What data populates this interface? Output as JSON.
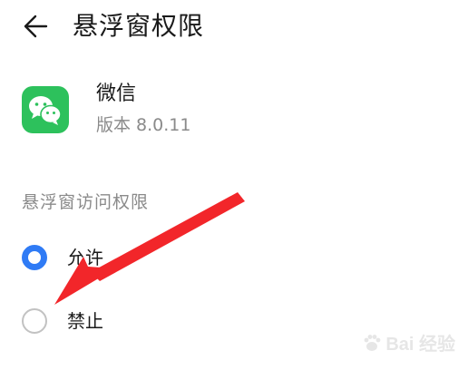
{
  "header": {
    "title": "悬浮窗权限",
    "back_icon": "arrow-left-icon"
  },
  "app": {
    "name": "微信",
    "version": "版本 8.0.11",
    "icon": "wechat-icon",
    "icon_color": "#2dc15c"
  },
  "permission": {
    "section_label": "悬浮窗访问权限",
    "options": [
      {
        "label": "允许",
        "selected": true
      },
      {
        "label": "禁止",
        "selected": false
      }
    ],
    "accent_color": "#2f7bf5"
  },
  "annotation": {
    "arrow_color": "#f2262a",
    "points_to": "禁止"
  },
  "watermark": {
    "text": "Bai 经验"
  }
}
